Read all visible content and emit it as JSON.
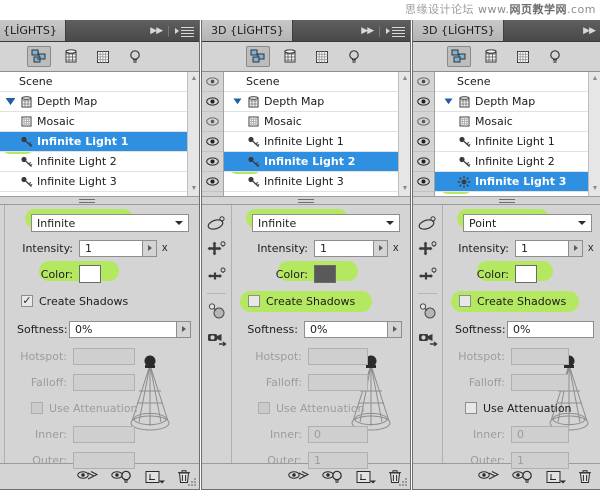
{
  "watermark": {
    "cn_text": "思缘设计论坛",
    "url_prefix": "www.",
    "url_bold": "网页教学网",
    "url_suffix": ".com"
  },
  "panel_title": "3D {LİGHTS}",
  "panel_title_clipped": "D {LİGHTS}",
  "filter_buttons": [
    {
      "name": "filter-scene-icon",
      "label": "Scene"
    },
    {
      "name": "filter-meshes-icon",
      "label": "Meshes"
    },
    {
      "name": "filter-materials-icon",
      "label": "Materials"
    },
    {
      "name": "filter-lights-icon",
      "label": "Lights"
    }
  ],
  "tabbar": {
    "collapse_label": "▶▶",
    "menu_label": "panel-menu"
  },
  "scene_tree": {
    "root_label": "Scene",
    "rows": [
      {
        "label": "Scene",
        "indent": 1,
        "icon": "none",
        "twirl": "none",
        "selected": false,
        "eye": true
      },
      {
        "label": "Depth Map",
        "indent": 1,
        "icon": "mesh-icon",
        "twirl": "open",
        "selected": false,
        "eye": true
      },
      {
        "label": "Mosaic",
        "indent": 2,
        "icon": "material-icon",
        "twirl": "none",
        "selected": false,
        "eye": true
      },
      {
        "label": "Infinite Light 1",
        "indent": 2,
        "icon": "infinite-light-icon",
        "twirl": "none",
        "selected": false,
        "eye": true
      },
      {
        "label": "Infinite Light 2",
        "indent": 2,
        "icon": "infinite-light-icon",
        "twirl": "none",
        "selected": false,
        "eye": true
      },
      {
        "label": "Infinite Light 3",
        "indent": 2,
        "icon": "infinite-light-icon",
        "twirl": "none",
        "selected": false,
        "eye": true
      }
    ]
  },
  "tools": [
    {
      "name": "rotate-light-tool",
      "label": "Rotate the Light"
    },
    {
      "name": "pan-light-tool",
      "label": "Pan the Light"
    },
    {
      "name": "slide-light-tool",
      "label": "Slide the Light"
    },
    {
      "name": "point-light-at-origin-tool",
      "label": "Point Light at Origin"
    },
    {
      "name": "move-light-to-view-tool",
      "label": "Move Light to Current View"
    }
  ],
  "labels": {
    "intensity": "Intensity:",
    "color": "Color:",
    "create_shadows": "Create Shadows",
    "softness": "Softness:",
    "hotspot": "Hotspot:",
    "falloff": "Falloff:",
    "use_attenuation": "Use Attenuation",
    "inner": "Inner:",
    "outer": "Outer:",
    "times": "x"
  },
  "bottom_toolbar": [
    {
      "name": "toggle-ground-plane-button",
      "label": "Toggle Misc 3D Extras"
    },
    {
      "name": "toggle-lights-button",
      "label": "Toggle Light Guides"
    },
    {
      "name": "add-new-light-button",
      "label": "Create a New Light"
    },
    {
      "name": "delete-light-button",
      "label": "Delete Light"
    }
  ],
  "panels": [
    {
      "id": "panel-1",
      "selected_row_index": 3,
      "selected_row_label": "Infinite Light 1",
      "light_type": "Infinite",
      "intensity": "1",
      "color_hex": "#ffffff",
      "create_shadows_checked": true,
      "softness": "0%",
      "hotspot": "",
      "falloff": "",
      "use_attenuation_checked": false,
      "use_attenuation_enabled": false,
      "inner": "",
      "outer": "",
      "light_icon": "infinite-light-icon"
    },
    {
      "id": "panel-2",
      "selected_row_index": 4,
      "selected_row_label": "Infinite Light 2",
      "light_type": "Infinite",
      "intensity": "1",
      "color_hex": "#595959",
      "create_shadows_checked": false,
      "softness": "0%",
      "hotspot": "",
      "falloff": "",
      "use_attenuation_checked": false,
      "use_attenuation_enabled": false,
      "inner": "0",
      "outer": "1",
      "light_icon": "infinite-light-icon"
    },
    {
      "id": "panel-3",
      "selected_row_index": 5,
      "selected_row_label": "Infinite Light 3",
      "light_type": "Point",
      "intensity": "1",
      "color_hex": "#ffffff",
      "create_shadows_checked": false,
      "softness": "0%",
      "hotspot": "",
      "falloff": "",
      "use_attenuation_checked": false,
      "use_attenuation_enabled": true,
      "inner": "0",
      "outer": "1",
      "light_icon": "point-light-icon"
    }
  ],
  "accent": {
    "selection_blue": "#2f8fe0",
    "highlighter_green": "#b5e861",
    "panel_gray": "#d4d4d4"
  }
}
